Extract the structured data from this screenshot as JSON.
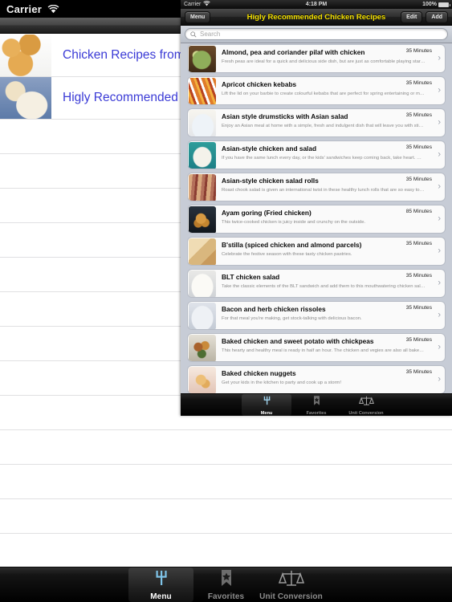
{
  "host": {
    "status_bar": {
      "carrier": "Carrier",
      "wifi_icon": "wifi-icon"
    },
    "rows": [
      {
        "label": "Chicken Recipes from previous app",
        "thumb": "fried-chicken-thumb"
      },
      {
        "label": "Higly Recommended Chicken Recipes",
        "thumb": "chicken-plate-thumb"
      }
    ],
    "empty_row_count": 12,
    "tabbar": {
      "tabs": [
        {
          "label": "Menu",
          "icon": "fork-icon",
          "selected": true
        },
        {
          "label": "Favorites",
          "icon": "star-bookmark-icon",
          "selected": false
        },
        {
          "label": "Unit Conversion",
          "icon": "scales-icon",
          "selected": false
        }
      ]
    }
  },
  "simulator": {
    "status_bar": {
      "carrier": "Carrier",
      "wifi_icon": "wifi-icon",
      "time": "4:18 PM",
      "battery_percent": "100%",
      "battery_icon": "battery-full-icon"
    },
    "navbar": {
      "back_label": "Menu",
      "title": "Higly Recommended Chicken Recipes",
      "title_color": "#f3e000",
      "edit_label": "Edit",
      "add_label": "Add"
    },
    "search": {
      "placeholder": "Search",
      "value": "",
      "icon": "search-icon"
    },
    "recipes": [
      {
        "title": "Almond, pea and coriander pilaf with chicken",
        "time": "35 Minutes",
        "desc": "Fresh peas are ideal for a quick and delicious side dish, but are just as comfortable playing star ingredient...",
        "thumb": "pilaf-bowl-thumb"
      },
      {
        "title": "Apricot chicken kebabs",
        "time": "35 Minutes",
        "desc": "Lift the lid on your barbie to create colourful kebabs that are perfect for spring entertaining or midweek dining.",
        "thumb": "kebabs-thumb"
      },
      {
        "title": "Asian style drumsticks with Asian salad",
        "time": "35 Minutes",
        "desc": "Enjoy an Asian meal at home with a simple, fresh and indulgent dish that will leave you with sticky fingers...",
        "thumb": "drumsticks-thumb"
      },
      {
        "title": "Asian-style chicken and salad",
        "time": "35 Minutes",
        "desc": "If you have the same lunch every day, or the kids' sandwiches keep coming back, take heart. With this new...",
        "thumb": "chicken-salad-thumb"
      },
      {
        "title": "Asian-style chicken salad rolls",
        "time": "35 Minutes",
        "desc": "Roast chook salad is given an international twist in these healthy lunch rolls that are so easy to make and...",
        "thumb": "salad-rolls-thumb"
      },
      {
        "title": "Ayam goring (Fried chicken)",
        "time": "85 Minutes",
        "desc": "This twice-cooked chicken is juicy inside and crunchy on the outside.",
        "thumb": "ayam-goring-thumb"
      },
      {
        "title": "B'stilla (spiced chicken and almond parcels)",
        "time": "35 Minutes",
        "desc": "Celebrate the festive season with these tasty chicken pastries.",
        "thumb": "bstilla-thumb"
      },
      {
        "title": "BLT chicken salad",
        "time": "35 Minutes",
        "desc": "Take the classic elements of the BLT sandwich and add them to this mouthwatering chicken salad.",
        "thumb": "blt-salad-thumb"
      },
      {
        "title": "Bacon and herb chicken rissoles",
        "time": "35 Minutes",
        "desc": "For that meal you're making, get stock-talking with delicious bacon.",
        "thumb": "rissoles-thumb"
      },
      {
        "title": "Baked chicken and sweet potato with chickpeas",
        "time": "35 Minutes",
        "desc": "This hearty and healthy meal is ready in half an hour. The chicken and vegies are also all baked in one tra...",
        "thumb": "baked-chickpeas-thumb"
      },
      {
        "title": "Baked chicken nuggets",
        "time": "35 Minutes",
        "desc": "Get your kids in the kitchen to party and cook up a storm!",
        "thumb": "nuggets-thumb"
      }
    ],
    "tabbar": {
      "tabs": [
        {
          "label": "Menu",
          "icon": "fork-icon",
          "selected": true
        },
        {
          "label": "Favorites",
          "icon": "star-bookmark-icon",
          "selected": false
        },
        {
          "label": "Unit Conversion",
          "icon": "scales-icon",
          "selected": false
        }
      ]
    }
  }
}
